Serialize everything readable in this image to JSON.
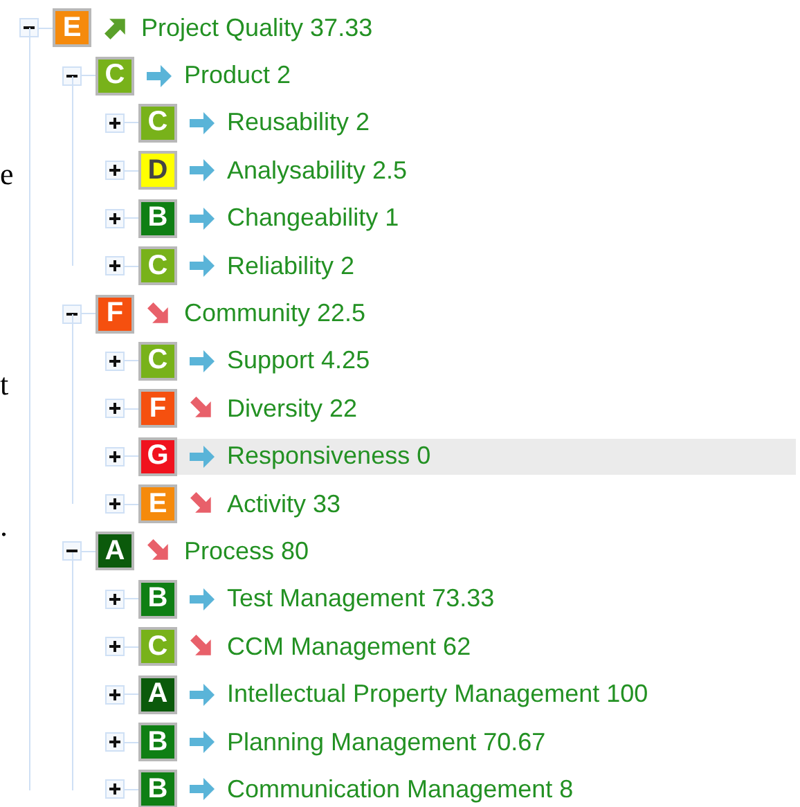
{
  "left_fragments": [
    "e",
    "t",
    "."
  ],
  "tree": [
    {
      "grade": "E",
      "color": "#f58a0c",
      "kind": "up",
      "label": "Project Quality 37.33",
      "expanded": true,
      "selected": false,
      "children": [
        {
          "grade": "C",
          "color": "#78b21a",
          "kind": "right",
          "label": "Product 2",
          "expanded": true,
          "selected": false,
          "children": [
            {
              "grade": "C",
              "color": "#78b21a",
              "kind": "right",
              "label": "Reusability 2",
              "expanded": false,
              "selected": false
            },
            {
              "grade": "D",
              "color": "#ffff00",
              "kind": "right",
              "label": "Analysability 2.5",
              "expanded": false,
              "selected": false
            },
            {
              "grade": "B",
              "color": "#0f7f14",
              "kind": "right",
              "label": "Changeability 1",
              "expanded": false,
              "selected": false
            },
            {
              "grade": "C",
              "color": "#78b21a",
              "kind": "right",
              "label": "Reliability 2",
              "expanded": false,
              "selected": false
            }
          ]
        },
        {
          "grade": "F",
          "color": "#f5500f",
          "kind": "down",
          "label": "Community 22.5",
          "expanded": true,
          "selected": false,
          "children": [
            {
              "grade": "C",
              "color": "#78b21a",
              "kind": "right",
              "label": "Support 4.25",
              "expanded": false,
              "selected": false
            },
            {
              "grade": "F",
              "color": "#f5500f",
              "kind": "down",
              "label": "Diversity 22",
              "expanded": false,
              "selected": false
            },
            {
              "grade": "G",
              "color": "#f0121e",
              "kind": "right",
              "label": "Responsiveness 0",
              "expanded": false,
              "selected": true
            },
            {
              "grade": "E",
              "color": "#f58a0c",
              "kind": "down",
              "label": "Activity 33",
              "expanded": false,
              "selected": false
            }
          ]
        },
        {
          "grade": "A",
          "color": "#0b5a0b",
          "kind": "down",
          "label": "Process 80",
          "expanded": true,
          "selected": false,
          "children": [
            {
              "grade": "B",
              "color": "#0f7f14",
              "kind": "right",
              "label": "Test Management 73.33",
              "expanded": false,
              "selected": false
            },
            {
              "grade": "C",
              "color": "#78b21a",
              "kind": "down",
              "label": "CCM Management 62",
              "expanded": false,
              "selected": false
            },
            {
              "grade": "A",
              "color": "#0b5a0b",
              "kind": "right",
              "label": "Intellectual Property Management 100",
              "expanded": false,
              "selected": false
            },
            {
              "grade": "B",
              "color": "#0f7f14",
              "kind": "right",
              "label": "Planning Management 70.67",
              "expanded": false,
              "selected": false
            },
            {
              "grade": "B",
              "color": "#0f7f14",
              "kind": "right",
              "label": "Communication Management 8",
              "expanded": false,
              "selected": false
            }
          ]
        }
      ]
    }
  ]
}
